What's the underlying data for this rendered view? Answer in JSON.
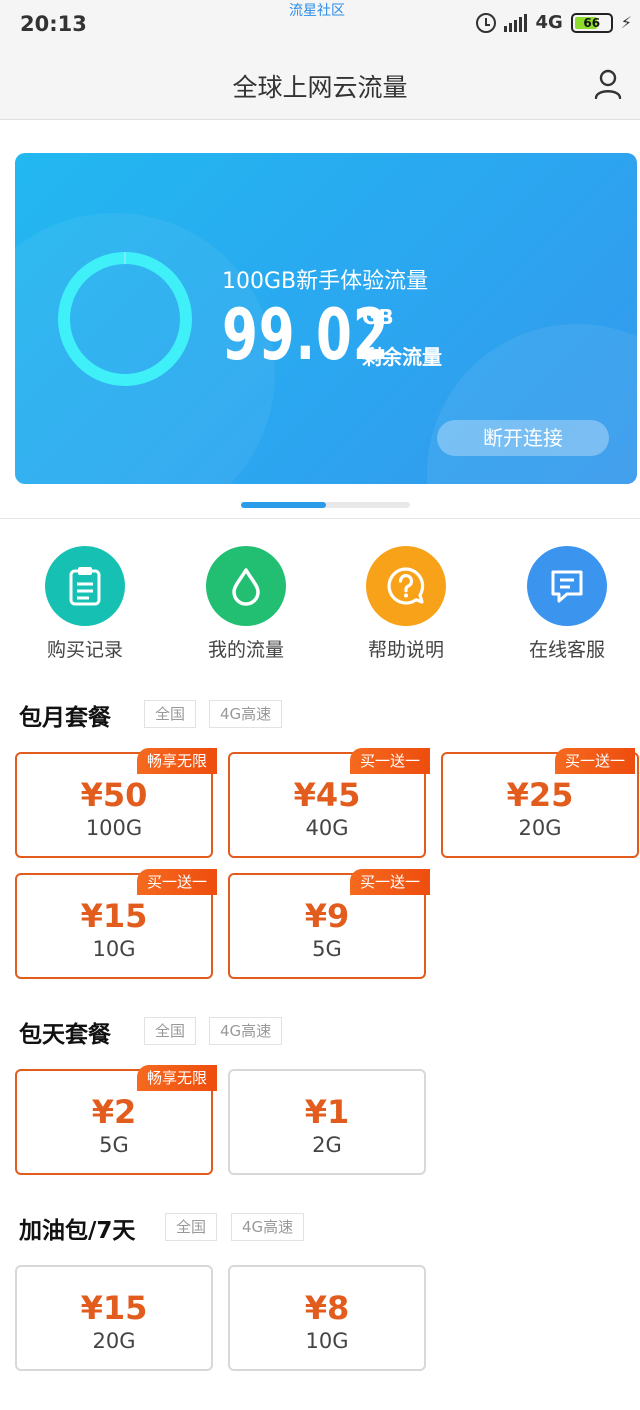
{
  "status_bar": {
    "time": "20:13",
    "watermark": "流星社区",
    "network": "4G",
    "battery": "66"
  },
  "nav": {
    "title": "全球上网云流量"
  },
  "banner": {
    "plan_name": "100GB新手体验流量",
    "remaining_value": "99.02",
    "remaining_unit": "GB",
    "remaining_label": "剩余流量",
    "disconnect_label": "断开连接"
  },
  "quick_actions": [
    {
      "label": "购买记录",
      "icon": "clipboard-icon",
      "color": "#16c1b4"
    },
    {
      "label": "我的流量",
      "icon": "drop-icon",
      "color": "#22bf73"
    },
    {
      "label": "帮助说明",
      "icon": "question-icon",
      "color": "#f8a21a"
    },
    {
      "label": "在线客服",
      "icon": "chat-icon",
      "color": "#3b95ee"
    }
  ],
  "monthly": {
    "title": "包月套餐",
    "tags": [
      "全国",
      "4G高速"
    ],
    "items": [
      {
        "price": "¥50",
        "size": "100G",
        "badge": "畅享无限"
      },
      {
        "price": "¥45",
        "size": "40G",
        "badge": "买一送一"
      },
      {
        "price": "¥25",
        "size": "20G",
        "badge": "买一送一"
      },
      {
        "price": "¥15",
        "size": "10G",
        "badge": "买一送一"
      },
      {
        "price": "¥9",
        "size": "5G",
        "badge": "买一送一"
      }
    ]
  },
  "daily": {
    "title": "包天套餐",
    "tags": [
      "全国",
      "4G高速"
    ],
    "items": [
      {
        "price": "¥2",
        "size": "5G",
        "badge": "畅享无限"
      },
      {
        "price": "¥1",
        "size": "2G",
        "badge": ""
      }
    ]
  },
  "addon": {
    "title": "加油包/7天",
    "tags": [
      "全国",
      "4G高速"
    ],
    "items": [
      {
        "price": "¥15",
        "size": "20G"
      },
      {
        "price": "¥8",
        "size": "10G"
      }
    ]
  },
  "colors": {
    "accent": "#e25c1e",
    "banner": "#2aa8f0",
    "ring": "#3ff0f8"
  }
}
